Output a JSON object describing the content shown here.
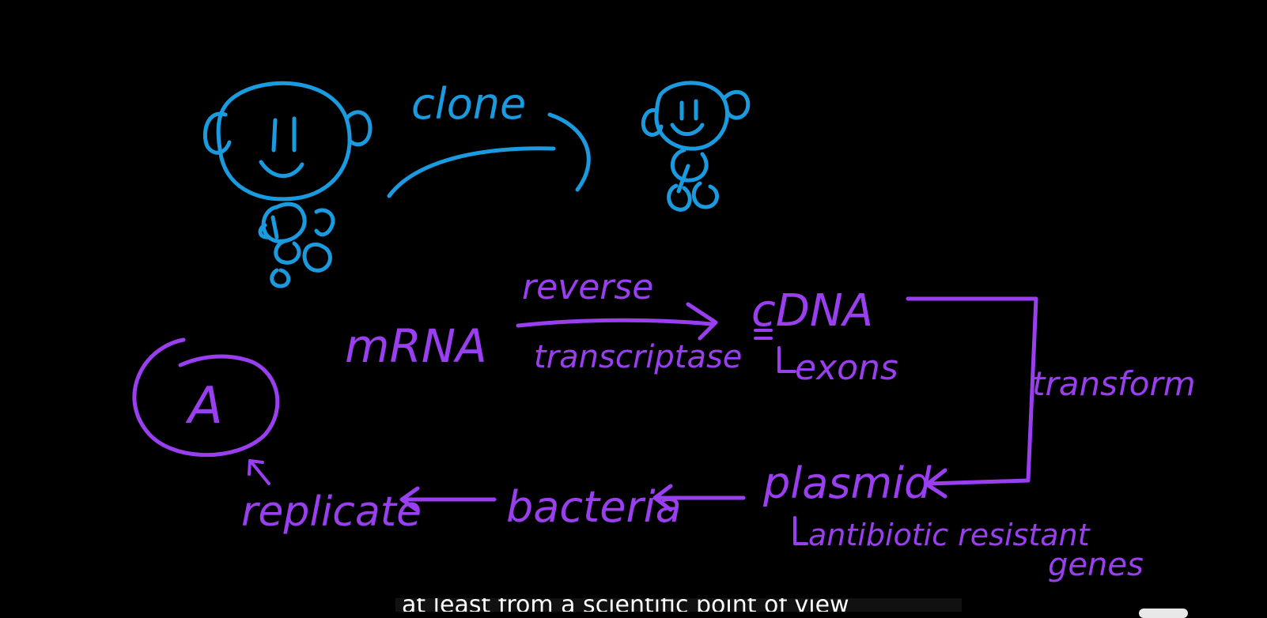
{
  "colors": {
    "background": "#000000",
    "blue_ink": "#1a9be0",
    "purple_ink": "#9a3ff0",
    "caption_bg": "#111111",
    "caption_text": "#ffffff"
  },
  "blue_section": {
    "clone_label": "clone"
  },
  "purple_section": {
    "mrna_label": "mRNA",
    "enzyme_top": "reverse",
    "enzyme_bottom": "transcriptase",
    "cdna_label": "cDNA",
    "exons_label": "exons",
    "transform_label": "transform",
    "plasmid_label": "plasmid",
    "antibiotic_label": "antibiotic resistant",
    "genes_label": "genes",
    "bacteria_label": "bacteria",
    "replicate_label": "replicate",
    "circled_letter": "A"
  },
  "caption": {
    "text": "at least from a scientific point of view"
  }
}
